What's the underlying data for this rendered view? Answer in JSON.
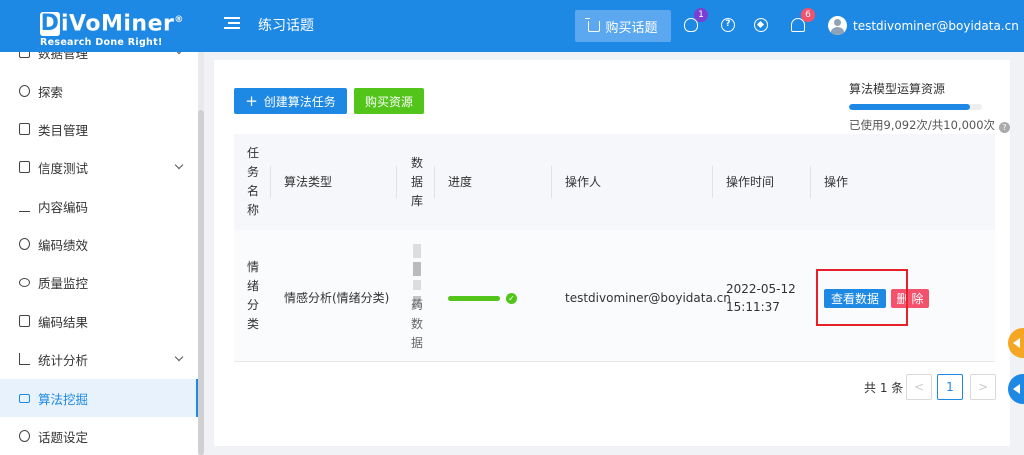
{
  "header": {
    "logo_brand": "iVoMiner",
    "logo_d": "D",
    "logo_reg": "®",
    "logo_slogan": "Research Done Right!",
    "page_title": "练习话题",
    "buy_topic_label": "购买话题",
    "notifications_badge": "1",
    "bell_badge": "6",
    "help_glyph": "?",
    "user_email": "testdivominer@boyidata.cn"
  },
  "sidebar": {
    "items": [
      {
        "label": "数据管理",
        "icon": "database-icon"
      },
      {
        "label": "探索",
        "icon": "dashboard-icon"
      },
      {
        "label": "类目管理",
        "icon": "file-icon"
      },
      {
        "label": "信度测试",
        "icon": "test-icon"
      },
      {
        "label": "内容编码",
        "icon": "edit-icon"
      },
      {
        "label": "编码绩效",
        "icon": "yen-icon"
      },
      {
        "label": "质量监控",
        "icon": "eye-icon"
      },
      {
        "label": "编码结果",
        "icon": "result-icon"
      },
      {
        "label": "统计分析",
        "icon": "bar-chart-icon"
      },
      {
        "label": "算法挖掘",
        "icon": "laptop-icon"
      },
      {
        "label": "话题设定",
        "icon": "gear-icon"
      }
    ]
  },
  "toolbar": {
    "create_label": "创建算法任务",
    "create_plus": "+",
    "buy_resource_label": "购买资源"
  },
  "quota": {
    "title": "算法模型运算资源",
    "used_text": "已使用9,092次/共10,000次",
    "used_fraction": 0.9092,
    "help_glyph": "?"
  },
  "table": {
    "columns": {
      "task_name": "任务名称",
      "algo_type": "算法类型",
      "database": "数据库",
      "progress": "进度",
      "operator": "操作人",
      "op_time": "操作时间",
      "actions": "操作"
    },
    "row": {
      "task_name": "情绪分类",
      "algo_type": "情感分析(情绪分类)",
      "database_tail": "药数据",
      "progress": 1.0,
      "done_glyph": "✓",
      "operator": "testdivominer@boyidata.cn",
      "op_date": "2022-05-12",
      "op_clock": "15:11:37",
      "view_label": "查看数据",
      "delete_label": "删除"
    }
  },
  "pagination": {
    "total": "共 1 条",
    "prev": "<",
    "current": "1",
    "next": ">"
  },
  "colors": {
    "primary": "#1e88e5",
    "success": "#52c41a",
    "danger": "#f4516c",
    "highlight": "#e8202a"
  }
}
